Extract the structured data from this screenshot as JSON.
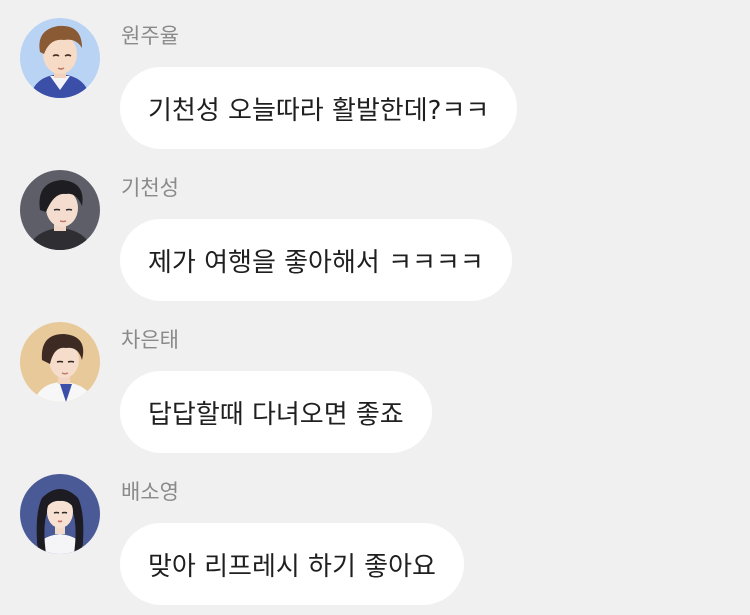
{
  "messages": [
    {
      "sender": "원주율",
      "text": "기천성 오늘따라 활발한데?ㅋㅋ",
      "avatar_icon": "male-avatar-brown-hair-blue-shirt"
    },
    {
      "sender": "기천성",
      "text": "제가 여행을 좋아해서 ㅋㅋㅋㅋ",
      "avatar_icon": "male-avatar-black-hair-dark-shirt"
    },
    {
      "sender": "차은태",
      "text": "답답할때 다녀오면 좋죠",
      "avatar_icon": "male-avatar-brown-hair-white-shirt"
    },
    {
      "sender": "배소영",
      "text": "맞아 리프레시 하기 좋아요",
      "avatar_icon": "female-avatar-long-black-hair"
    }
  ],
  "colors": {
    "background": "#f0f0f0",
    "bubble": "#ffffff",
    "name_text": "#8a8a8a",
    "message_text": "#1f1f1f"
  }
}
